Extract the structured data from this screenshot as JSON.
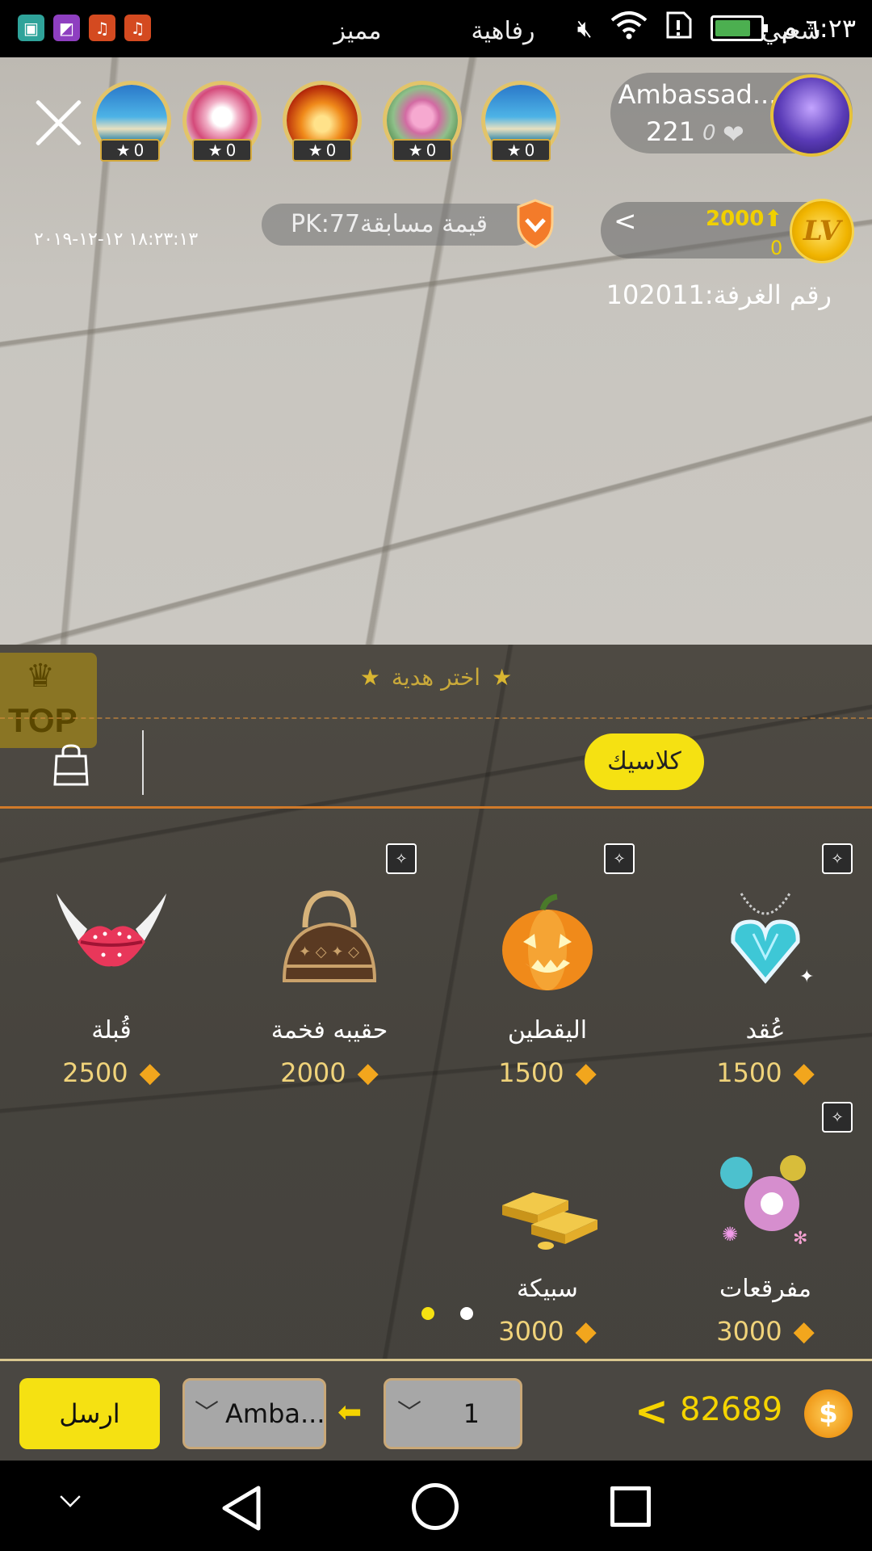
{
  "status_bar": {
    "time": "٦:٢٣ م",
    "apps": [
      "android-icon",
      "gallery-icon",
      "music-icon",
      "music-icon"
    ],
    "battery_level_pct": 80
  },
  "stream": {
    "host_name": "Ambassad...",
    "host_count": "221",
    "host_hearts": "0",
    "viewers": [
      {
        "badge": "0"
      },
      {
        "badge": "0"
      },
      {
        "badge": "0"
      },
      {
        "badge": "0"
      },
      {
        "badge": "0"
      }
    ],
    "level_score": "2000",
    "level_sub": "0",
    "level_label": "LV",
    "room_number": "رقم الغرفة:102011",
    "pk_label": "قيمة مسابقةPK:77",
    "datetime": "١٨:٢٣:١٣ ١٢-١٢-٢٠١٩"
  },
  "gift_panel": {
    "top_label": "TOP",
    "title": "اختر هدية",
    "tabs": [
      {
        "label": "شعبي"
      },
      {
        "label": "كلاسيك"
      },
      {
        "label": "رفاهية"
      },
      {
        "label": "مميز"
      }
    ],
    "active_tab": "كلاسيك",
    "gifts": [
      {
        "name": "عُقد",
        "price": "1500",
        "icon": "necklace-icon"
      },
      {
        "name": "اليقطين",
        "price": "1500",
        "icon": "pumpkin-icon"
      },
      {
        "name": "حقيبه فخمة",
        "price": "2000",
        "icon": "handbag-icon"
      },
      {
        "name": "قُبلة",
        "price": "2500",
        "icon": "kiss-icon"
      },
      {
        "name": "مفرقعات",
        "price": "3000",
        "icon": "fireworks-icon"
      },
      {
        "name": "سبيكة",
        "price": "3000",
        "icon": "gold-bar-icon"
      }
    ],
    "page_indicator": {
      "pages": 2,
      "current": 1
    }
  },
  "bottom_bar": {
    "send_label": "ارسل",
    "recipient": "Amba...",
    "quantity": "1",
    "balance": "82689",
    "coin_symbol": "$"
  },
  "colors": {
    "accent_yellow": "#f5e112",
    "gold_text": "#f0d37a",
    "diamond": "#f2a61d",
    "panel_bg": "#4a4742"
  }
}
